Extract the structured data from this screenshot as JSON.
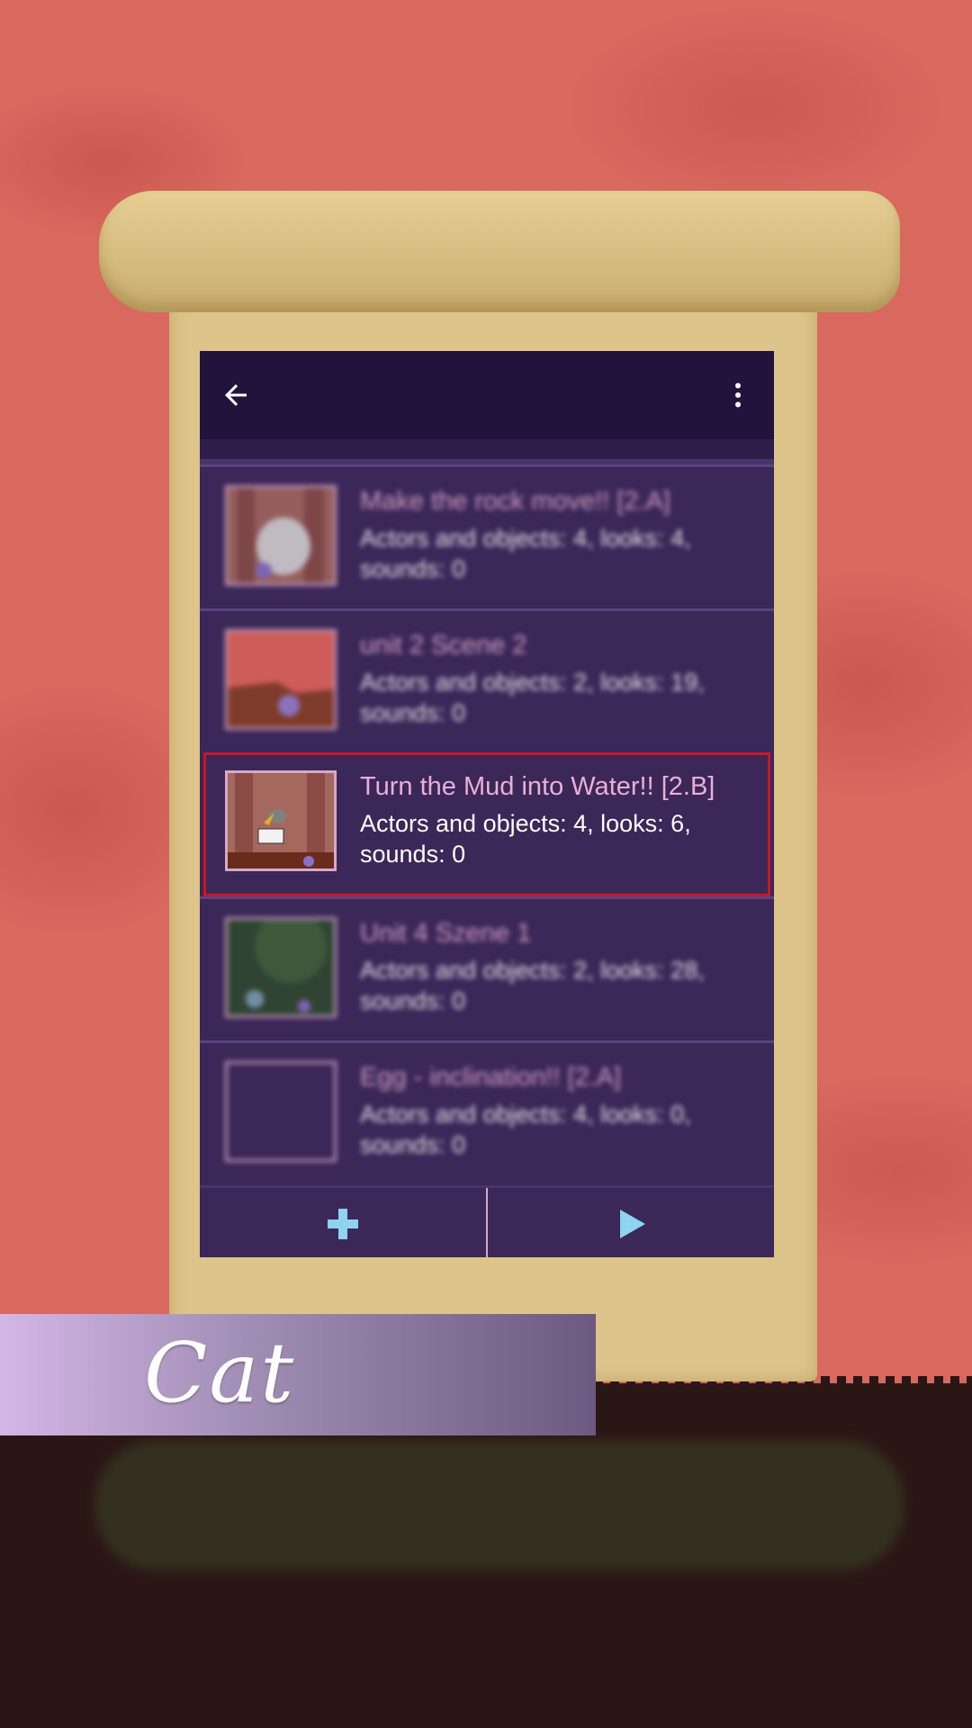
{
  "scene_name": "Cat",
  "toolbar": {
    "back_icon": "arrow-left-icon",
    "menu_icon": "more-vert-icon"
  },
  "scenes": [
    {
      "title": "Make the rock move!! [2.A]",
      "details": "Actors and objects: 4, looks: 4, sounds: 0",
      "selected": false
    },
    {
      "title": "unit 2 Scene 2",
      "details": "Actors and objects: 2, looks: 19, sounds: 0",
      "selected": false
    },
    {
      "title": "Turn the Mud into Water!! [2.B]",
      "details": "Actors and objects: 4, looks: 6, sounds: 0",
      "selected": true
    },
    {
      "title": "Unit 4 Szene 1",
      "details": "Actors and objects: 2, looks: 28, sounds: 0",
      "selected": false
    },
    {
      "title": "Egg - inclination!! [2.A]",
      "details": "Actors and objects: 4, looks: 0, sounds: 0",
      "selected": false
    }
  ],
  "bottom_bar": {
    "add_icon": "plus-icon",
    "play_icon": "play-icon"
  },
  "colors": {
    "accent": "#8fd3f0",
    "title": "#e8b0d6",
    "selection": "#c8162a"
  }
}
